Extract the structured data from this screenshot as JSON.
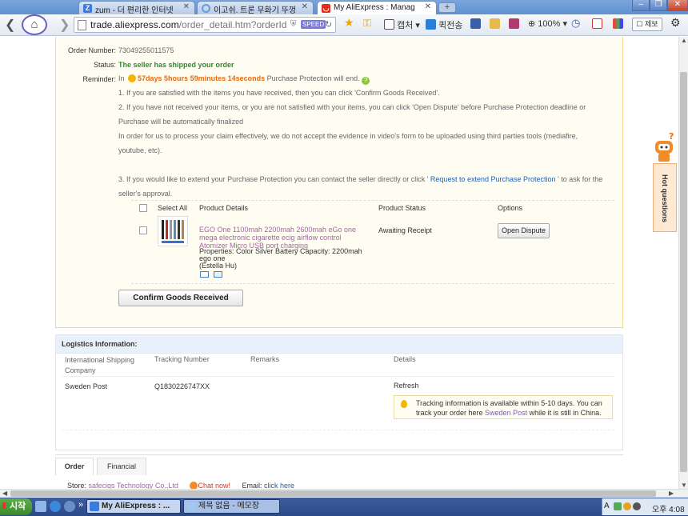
{
  "browser": {
    "tabs": [
      {
        "label": "zum - 더 편리한 인터넷",
        "icon": "zum-icon"
      },
      {
        "label": "이고쉬. 트론 무화기 뚜껑",
        "icon": "loading-icon"
      },
      {
        "label": "My AliExpress : Manag",
        "icon": "aliexpress-icon"
      }
    ],
    "new_tab": "+",
    "url_main": "trade.aliexpress.com",
    "url_path": "/order_detail.htm?orderId",
    "speed_badge": "SPEED",
    "toolbar": {
      "capture": "캡처",
      "quick_send": "퀵전송",
      "zoom": "100%",
      "memo": "제보"
    }
  },
  "order": {
    "number_label": "Order Number:",
    "number": "73049255011575",
    "status_label": "Status:",
    "status": "The seller has shipped your order",
    "reminder_label": "Reminder:",
    "reminder_prefix": "In",
    "countdown": "57days 5hours 59minutes 14seconds",
    "reminder_suffix": "Purchase Protection will end.",
    "info": [
      "1. If you are satisfied with the items you have received, then you can click 'Confirm Goods Received'.",
      "2. If you have not received your items, or you are not satisfied with your items, you can click 'Open Dispute' before Purchase Protection deadline or",
      "Purchase will be automatically finalized",
      "In order for us to process your claim effectively, we do not accept the evidence in video's form to be uploaded using third parties tools (mediafire,",
      "youtube, etc)."
    ],
    "extend_prefix": "3. If you would like to extend your Purchase Protection you can contact the seller directly or click '",
    "extend_link": " Request to extend Purchase Protection ",
    "extend_suffix": "' to ask for the",
    "extend_line2": "seller's approval.",
    "table_headers": {
      "select_all": "Select All",
      "product_details": "Product Details",
      "product_status": "Product Status",
      "options": "Options"
    },
    "product": {
      "title": "EGO One 1100mah 2200mah 2600mah eGo one mega electronic cigarette ecig airflow control Atomizer Micro USB port charging",
      "properties": "Properties: Color Silver Battery Capacity: 2200mah ego one",
      "seller_name": "(Estella Hu)",
      "status": "Awaiting Receipt",
      "option_button": "Open Dispute"
    },
    "confirm_button": "Confirm Goods Received"
  },
  "logistics": {
    "header": "Logistics Information:",
    "columns": [
      "International Shipping Company",
      "Tracking Number",
      "Remarks",
      "Details"
    ],
    "row": {
      "company": "Sweden Post",
      "tracking": "Q1830226747XX",
      "remarks": "",
      "details_link": "Refresh"
    },
    "tip_prefix": "Tracking information is available within 5-10 days. You can track your order here",
    "tip_link": " Sweden Post",
    "tip_suffix": " while it is still in China."
  },
  "bottom_tabs": [
    "Order",
    "Financial"
  ],
  "store": {
    "label": "Store:",
    "name": "safecigs Technology Co.,Ltd",
    "chat": "Chat now!",
    "email_label": "Email:",
    "email_link": "click here"
  },
  "hot_questions": "Hot questions",
  "taskbar": {
    "start": "시작",
    "chevron": "»",
    "items": [
      "My AliExpress : ...",
      "제목 없음 - 메모장"
    ],
    "clock": "오후 4:08"
  }
}
